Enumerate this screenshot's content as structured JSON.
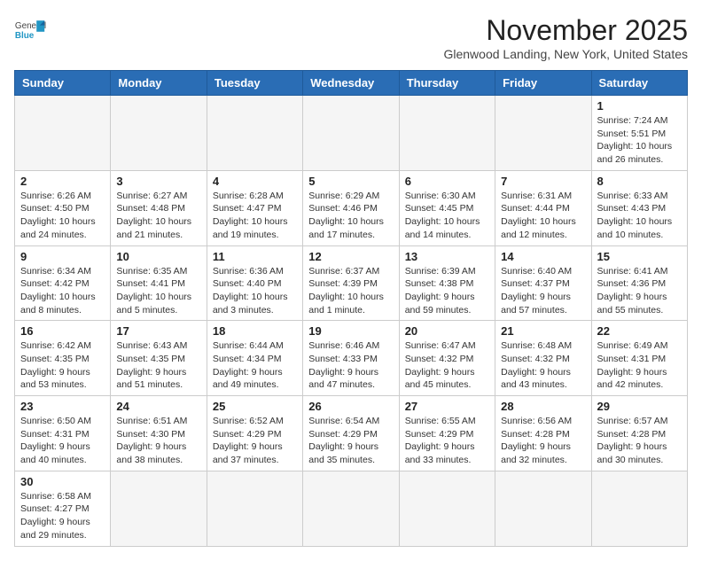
{
  "header": {
    "title": "November 2025",
    "subtitle": "Glenwood Landing, New York, United States",
    "logo_general": "General",
    "logo_blue": "Blue"
  },
  "weekdays": [
    "Sunday",
    "Monday",
    "Tuesday",
    "Wednesday",
    "Thursday",
    "Friday",
    "Saturday"
  ],
  "weeks": [
    [
      {
        "day": "",
        "info": ""
      },
      {
        "day": "",
        "info": ""
      },
      {
        "day": "",
        "info": ""
      },
      {
        "day": "",
        "info": ""
      },
      {
        "day": "",
        "info": ""
      },
      {
        "day": "",
        "info": ""
      },
      {
        "day": "1",
        "info": "Sunrise: 7:24 AM\nSunset: 5:51 PM\nDaylight: 10 hours\nand 26 minutes."
      }
    ],
    [
      {
        "day": "2",
        "info": "Sunrise: 6:26 AM\nSunset: 4:50 PM\nDaylight: 10 hours\nand 24 minutes."
      },
      {
        "day": "3",
        "info": "Sunrise: 6:27 AM\nSunset: 4:48 PM\nDaylight: 10 hours\nand 21 minutes."
      },
      {
        "day": "4",
        "info": "Sunrise: 6:28 AM\nSunset: 4:47 PM\nDaylight: 10 hours\nand 19 minutes."
      },
      {
        "day": "5",
        "info": "Sunrise: 6:29 AM\nSunset: 4:46 PM\nDaylight: 10 hours\nand 17 minutes."
      },
      {
        "day": "6",
        "info": "Sunrise: 6:30 AM\nSunset: 4:45 PM\nDaylight: 10 hours\nand 14 minutes."
      },
      {
        "day": "7",
        "info": "Sunrise: 6:31 AM\nSunset: 4:44 PM\nDaylight: 10 hours\nand 12 minutes."
      },
      {
        "day": "8",
        "info": "Sunrise: 6:33 AM\nSunset: 4:43 PM\nDaylight: 10 hours\nand 10 minutes."
      }
    ],
    [
      {
        "day": "9",
        "info": "Sunrise: 6:34 AM\nSunset: 4:42 PM\nDaylight: 10 hours\nand 8 minutes."
      },
      {
        "day": "10",
        "info": "Sunrise: 6:35 AM\nSunset: 4:41 PM\nDaylight: 10 hours\nand 5 minutes."
      },
      {
        "day": "11",
        "info": "Sunrise: 6:36 AM\nSunset: 4:40 PM\nDaylight: 10 hours\nand 3 minutes."
      },
      {
        "day": "12",
        "info": "Sunrise: 6:37 AM\nSunset: 4:39 PM\nDaylight: 10 hours\nand 1 minute."
      },
      {
        "day": "13",
        "info": "Sunrise: 6:39 AM\nSunset: 4:38 PM\nDaylight: 9 hours\nand 59 minutes."
      },
      {
        "day": "14",
        "info": "Sunrise: 6:40 AM\nSunset: 4:37 PM\nDaylight: 9 hours\nand 57 minutes."
      },
      {
        "day": "15",
        "info": "Sunrise: 6:41 AM\nSunset: 4:36 PM\nDaylight: 9 hours\nand 55 minutes."
      }
    ],
    [
      {
        "day": "16",
        "info": "Sunrise: 6:42 AM\nSunset: 4:35 PM\nDaylight: 9 hours\nand 53 minutes."
      },
      {
        "day": "17",
        "info": "Sunrise: 6:43 AM\nSunset: 4:35 PM\nDaylight: 9 hours\nand 51 minutes."
      },
      {
        "day": "18",
        "info": "Sunrise: 6:44 AM\nSunset: 4:34 PM\nDaylight: 9 hours\nand 49 minutes."
      },
      {
        "day": "19",
        "info": "Sunrise: 6:46 AM\nSunset: 4:33 PM\nDaylight: 9 hours\nand 47 minutes."
      },
      {
        "day": "20",
        "info": "Sunrise: 6:47 AM\nSunset: 4:32 PM\nDaylight: 9 hours\nand 45 minutes."
      },
      {
        "day": "21",
        "info": "Sunrise: 6:48 AM\nSunset: 4:32 PM\nDaylight: 9 hours\nand 43 minutes."
      },
      {
        "day": "22",
        "info": "Sunrise: 6:49 AM\nSunset: 4:31 PM\nDaylight: 9 hours\nand 42 minutes."
      }
    ],
    [
      {
        "day": "23",
        "info": "Sunrise: 6:50 AM\nSunset: 4:31 PM\nDaylight: 9 hours\nand 40 minutes."
      },
      {
        "day": "24",
        "info": "Sunrise: 6:51 AM\nSunset: 4:30 PM\nDaylight: 9 hours\nand 38 minutes."
      },
      {
        "day": "25",
        "info": "Sunrise: 6:52 AM\nSunset: 4:29 PM\nDaylight: 9 hours\nand 37 minutes."
      },
      {
        "day": "26",
        "info": "Sunrise: 6:54 AM\nSunset: 4:29 PM\nDaylight: 9 hours\nand 35 minutes."
      },
      {
        "day": "27",
        "info": "Sunrise: 6:55 AM\nSunset: 4:29 PM\nDaylight: 9 hours\nand 33 minutes."
      },
      {
        "day": "28",
        "info": "Sunrise: 6:56 AM\nSunset: 4:28 PM\nDaylight: 9 hours\nand 32 minutes."
      },
      {
        "day": "29",
        "info": "Sunrise: 6:57 AM\nSunset: 4:28 PM\nDaylight: 9 hours\nand 30 minutes."
      }
    ],
    [
      {
        "day": "30",
        "info": "Sunrise: 6:58 AM\nSunset: 4:27 PM\nDaylight: 9 hours\nand 29 minutes."
      },
      {
        "day": "",
        "info": ""
      },
      {
        "day": "",
        "info": ""
      },
      {
        "day": "",
        "info": ""
      },
      {
        "day": "",
        "info": ""
      },
      {
        "day": "",
        "info": ""
      },
      {
        "day": "",
        "info": ""
      }
    ]
  ]
}
